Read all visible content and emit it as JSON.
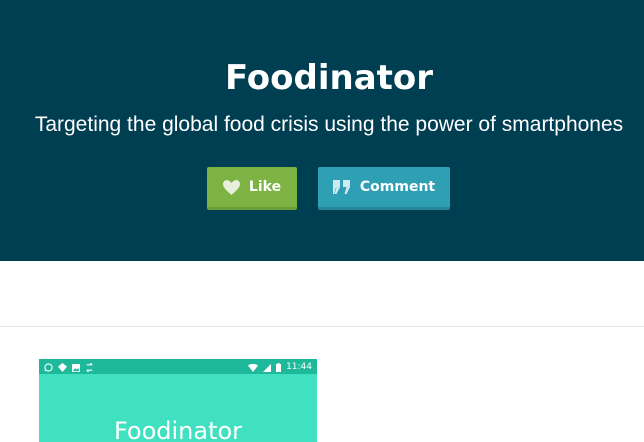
{
  "hero": {
    "title": "Foodinator",
    "subtitle": "Targeting the global food crisis using the power of smartphones",
    "like_label": "Like",
    "comment_label": "Comment"
  },
  "phone_screenshot": {
    "status_time": "11:44",
    "app_title": "Foodinator",
    "status_icons_left": [
      "whatsapp-icon",
      "location-icon",
      "image-icon",
      "sync-icon"
    ],
    "status_icons_right": [
      "wifi-icon",
      "signal-icon",
      "battery-icon"
    ]
  },
  "colors": {
    "hero_background": "#003e52",
    "like_button": "#7cb342",
    "comment_button": "#2f9fb4",
    "phone_statusbar": "#1db99a",
    "phone_background": "#40e0c0"
  }
}
